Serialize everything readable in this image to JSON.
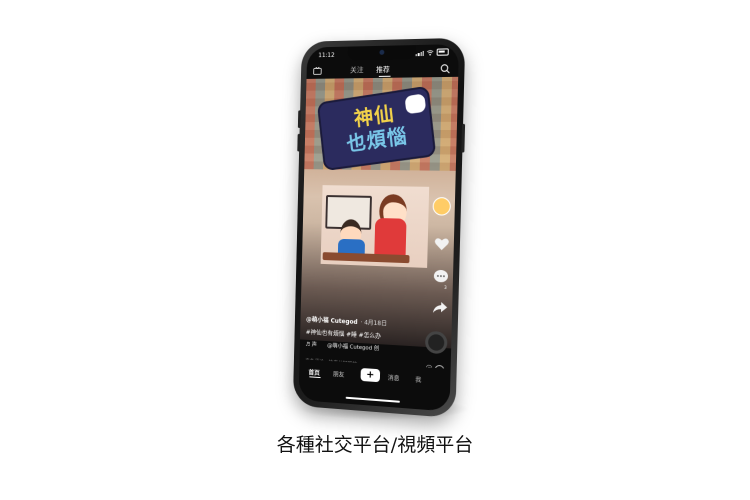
{
  "status_bar": {
    "time": "11:12"
  },
  "top_nav": {
    "tab_follow": "关注",
    "tab_recommend": "推荐"
  },
  "video": {
    "title_line1": "神仙",
    "title_line2": "也煩惱"
  },
  "rail": {
    "comments": "3"
  },
  "caption": {
    "author": "@萌小福 Cutegod",
    "date": "· 4月18日",
    "hashtags": "#神仙也有煩惱 #睡 #怎么办",
    "music": "♬ 声　　@萌小福 Cutegod 创"
  },
  "comment_box": {
    "placeholder": "看条评论，快来儿好吧的～"
  },
  "bottom_nav": {
    "home": "首页",
    "friends": "朋友",
    "plus": "+",
    "inbox": "消息",
    "me": "我"
  },
  "footer_caption": "各種社交平台/視頻平台",
  "colors": {
    "accent_red": "#e03a3a",
    "title_yellow": "#f2d24a",
    "title_blue": "#79c6e8"
  }
}
